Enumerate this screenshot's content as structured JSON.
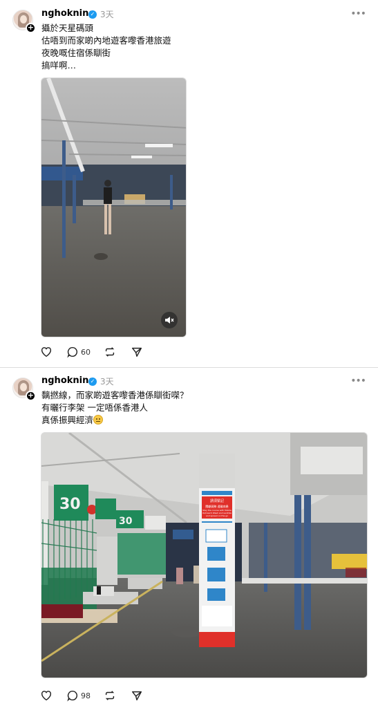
{
  "posts": [
    {
      "username": "nghokning",
      "time": "3天",
      "caption_lines": [
        "攝於天星碼頭",
        "估唔到而家啲內地遊客嚟香港旅遊",
        "夜晚嘅住宿係瞓街",
        "搞咩啊…"
      ],
      "media_type": "video",
      "stats": {
        "replies": "60"
      }
    },
    {
      "username": "nghokning",
      "time": "3天",
      "caption_lines": [
        "黐撚線，而家啲遊客嚟香港係瞓街㗎？",
        "有曬行李架 一定唔係香港人",
        "真係振興經濟"
      ],
      "media_type": "image",
      "sign": {
        "title": "請須緊記",
        "subtitle": "關顧弱勢 遠離病患",
        "body": "Stay the course with Mobile Outreach Wash and sanitize and spread on the go"
      },
      "stats": {
        "replies": "98"
      }
    }
  ],
  "icons": {
    "verified": "verified-badge-icon",
    "more": "more-options-icon",
    "like": "heart-icon",
    "reply": "comment-icon",
    "repost": "repost-icon",
    "share": "send-icon",
    "mute": "muted-speaker-icon",
    "follow": "plus-icon"
  },
  "colors": {
    "verified": "#1d9bf0",
    "muted_text": "#999999",
    "sign_red": "#e0302a",
    "gate_green": "#1f8a5a"
  }
}
